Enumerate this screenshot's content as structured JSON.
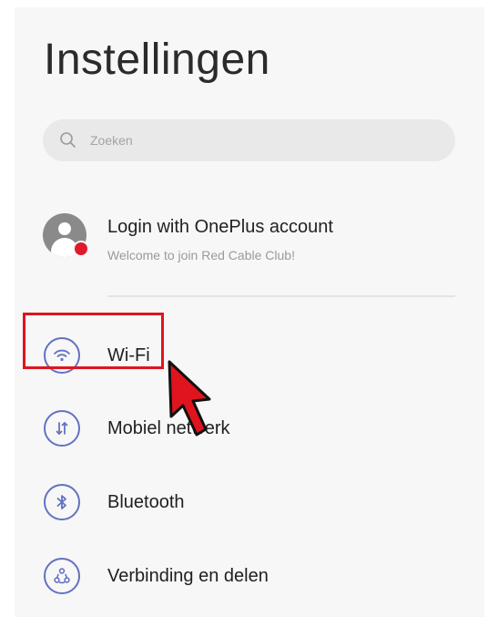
{
  "header": {
    "title": "Instellingen"
  },
  "search": {
    "placeholder": "Zoeken"
  },
  "account": {
    "title": "Login with OnePlus account",
    "subtitle": "Welcome to join Red Cable Club!"
  },
  "settings_items": [
    {
      "label": "Wi-Fi",
      "icon": "wifi-icon"
    },
    {
      "label": "Mobiel netwerk",
      "icon": "mobile-data-icon"
    },
    {
      "label": "Bluetooth",
      "icon": "bluetooth-icon"
    },
    {
      "label": "Verbinding en delen",
      "icon": "connection-sharing-icon"
    }
  ],
  "colors": {
    "icon_accent": "#6272c2",
    "highlight": "#e0141e",
    "badge": "#e0192b"
  }
}
